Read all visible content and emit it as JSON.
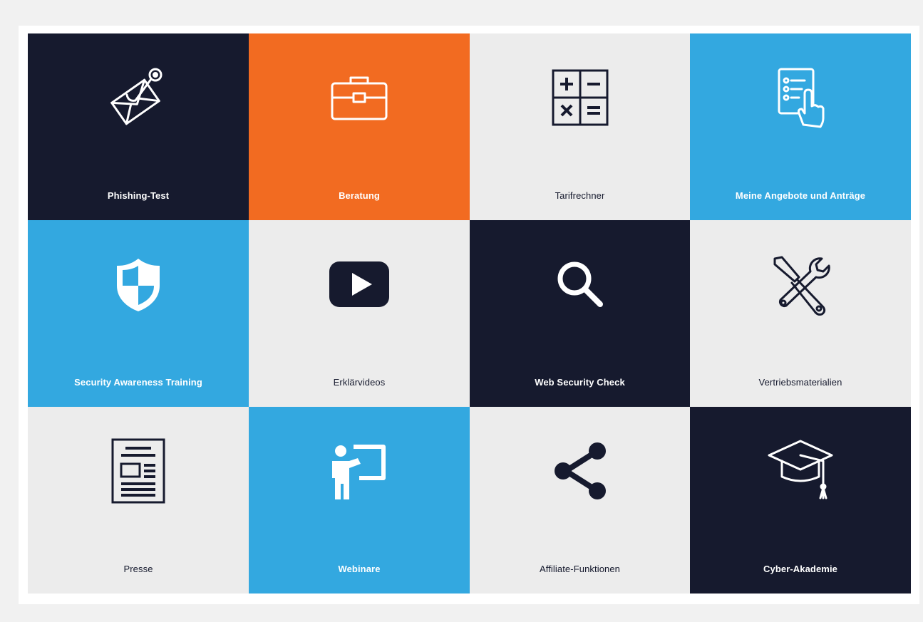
{
  "tiles": [
    {
      "label": "Phishing-Test",
      "icon": "phishing-envelope-icon"
    },
    {
      "label": "Beratung",
      "icon": "briefcase-icon"
    },
    {
      "label": "Tarifrechner",
      "icon": "calculator-icon"
    },
    {
      "label": "Meine Angebote und Anträge",
      "icon": "checklist-hand-icon"
    },
    {
      "label": "Security Awareness Training",
      "icon": "shield-icon"
    },
    {
      "label": "Erklärvideos",
      "icon": "play-video-icon"
    },
    {
      "label": "Web Security Check",
      "icon": "magnifier-icon"
    },
    {
      "label": "Vertriebsmaterialien",
      "icon": "tools-icon"
    },
    {
      "label": "Presse",
      "icon": "newspaper-icon"
    },
    {
      "label": "Webinare",
      "icon": "presenter-icon"
    },
    {
      "label": "Affiliate-Funktionen",
      "icon": "share-icon"
    },
    {
      "label": "Cyber-Akademie",
      "icon": "graduation-cap-icon"
    }
  ],
  "colors": {
    "dark": "#161a2e",
    "orange": "#f26b21",
    "blue": "#33a8e0",
    "light": "#ececec"
  }
}
